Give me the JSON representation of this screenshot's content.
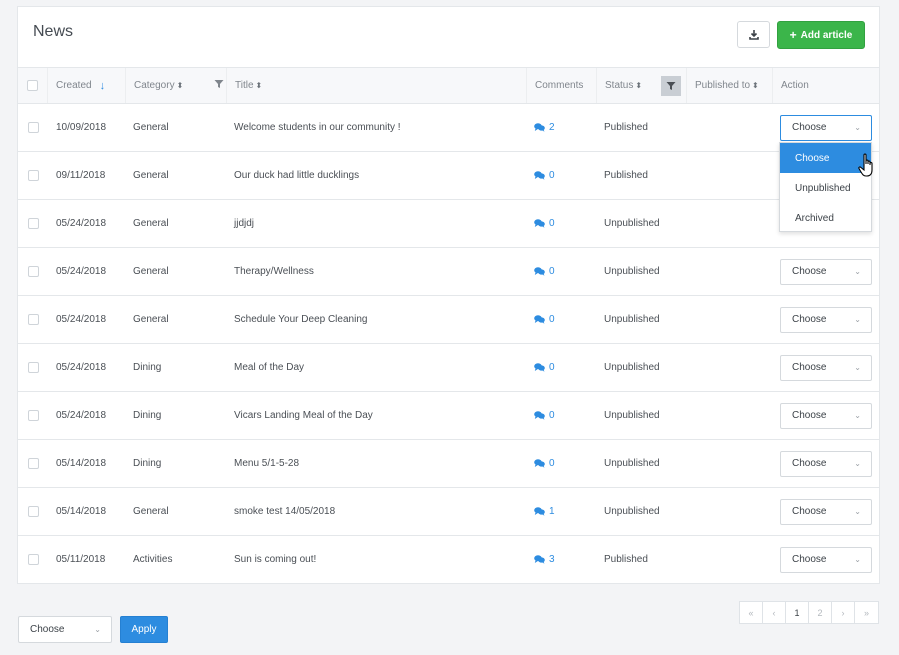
{
  "header": {
    "title": "News",
    "add_label": "Add article"
  },
  "table": {
    "columns": {
      "created": "Created",
      "category": "Category",
      "title": "Title",
      "comments": "Comments",
      "status": "Status",
      "published_to": "Published to",
      "action": "Action"
    },
    "rows": [
      {
        "created": "10/09/2018",
        "category": "General",
        "title": "Welcome students in our community !",
        "comments": "2",
        "status": "Published",
        "action": "Choose"
      },
      {
        "created": "09/11/2018",
        "category": "General",
        "title": "Our duck had little ducklings",
        "comments": "0",
        "status": "Published",
        "action": "Choose"
      },
      {
        "created": "05/24/2018",
        "category": "General",
        "title": "jjdjdj",
        "comments": "0",
        "status": "Unpublished",
        "action": "Choose"
      },
      {
        "created": "05/24/2018",
        "category": "General",
        "title": "Therapy/Wellness",
        "comments": "0",
        "status": "Unpublished",
        "action": "Choose"
      },
      {
        "created": "05/24/2018",
        "category": "General",
        "title": "Schedule Your Deep Cleaning",
        "comments": "0",
        "status": "Unpublished",
        "action": "Choose"
      },
      {
        "created": "05/24/2018",
        "category": "Dining",
        "title": "Meal of the Day",
        "comments": "0",
        "status": "Unpublished",
        "action": "Choose"
      },
      {
        "created": "05/24/2018",
        "category": "Dining",
        "title": "Vicars Landing Meal of the Day",
        "comments": "0",
        "status": "Unpublished",
        "action": "Choose"
      },
      {
        "created": "05/14/2018",
        "category": "Dining",
        "title": "Menu 5/1-5-28",
        "comments": "0",
        "status": "Unpublished",
        "action": "Choose"
      },
      {
        "created": "05/14/2018",
        "category": "General",
        "title": "smoke test 14/05/2018",
        "comments": "1",
        "status": "Unpublished",
        "action": "Choose"
      },
      {
        "created": "05/11/2018",
        "category": "Activities",
        "title": "Sun is coming out!",
        "comments": "3",
        "status": "Published",
        "action": "Choose"
      }
    ]
  },
  "action_dropdown": {
    "options": [
      "Choose",
      "Unpublished",
      "Archived"
    ],
    "selected": "Choose"
  },
  "bulk": {
    "select_value": "Choose",
    "apply_label": "Apply"
  },
  "pagination": {
    "pages": [
      "1",
      "2"
    ],
    "current": "1"
  },
  "colors": {
    "accent": "#2d8ce0",
    "add_button": "#3bb54a"
  }
}
